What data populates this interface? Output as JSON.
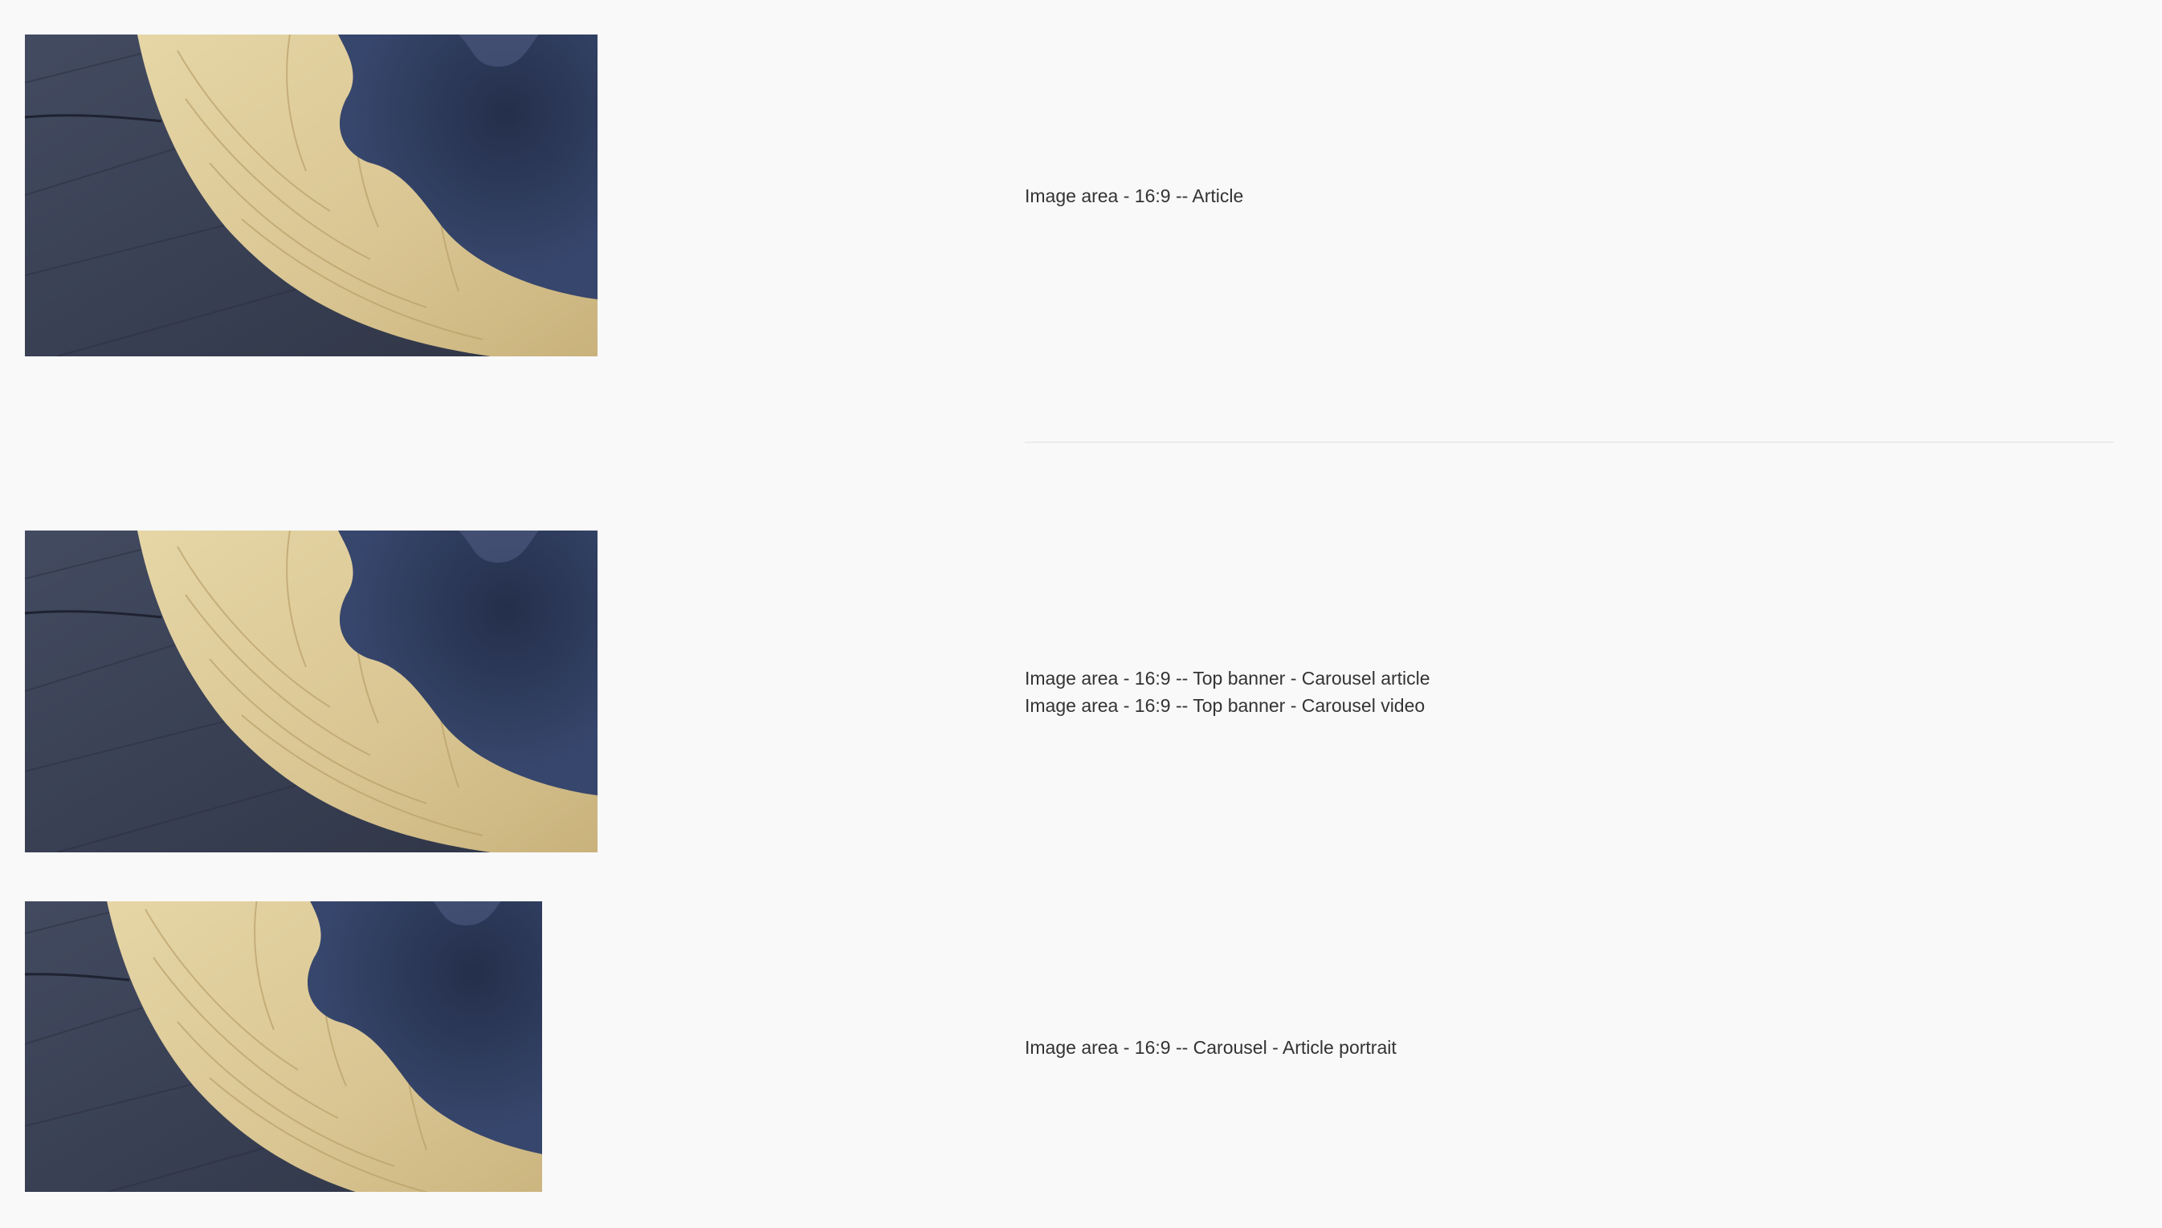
{
  "rows": [
    {
      "image_alt": "Aerial view of sand dune",
      "caption_lines": [
        "Image area - 16:9 -- Article"
      ]
    },
    {
      "image_alt": "Aerial view of sand dune",
      "caption_lines": [
        "Image area - 16:9 -- Top banner - Carousel article",
        "Image area - 16:9 -- Top banner - Carousel video"
      ]
    },
    {
      "image_alt": "Aerial view of sand dune",
      "caption_lines": [
        "Image area - 16:9 -- Carousel - Article portrait"
      ]
    }
  ],
  "colors": {
    "background": "#f9f9f9",
    "caption_text": "#333333",
    "divider": "#ececec",
    "sand": "#dccb9a",
    "dark_sand": "#3a4156",
    "shadow": "#2c3a5c"
  }
}
